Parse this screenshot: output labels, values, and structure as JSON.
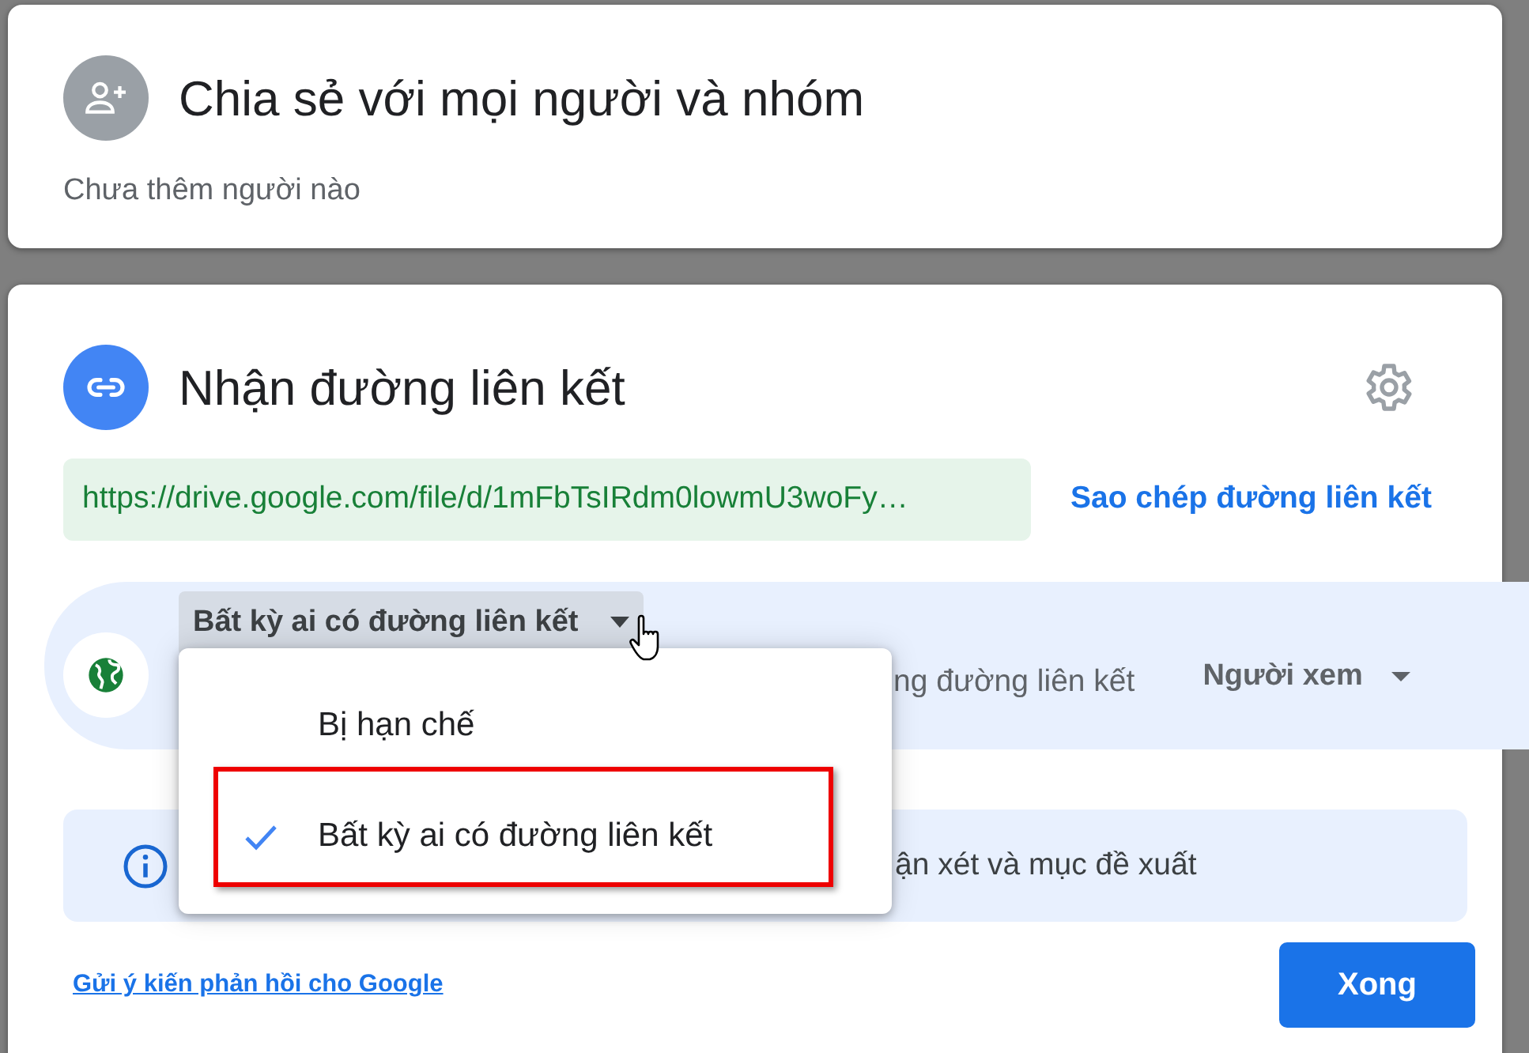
{
  "share_card": {
    "title": "Chia sẻ với mọi người và nhóm",
    "subtitle": "Chưa thêm người nào"
  },
  "link_card": {
    "title": "Nhận đường liên kết",
    "url": "https://drive.google.com/file/d/1mFbTsIRdm0lowmU3woFy…",
    "copy_link": "Sao chép đường liên kết",
    "access": {
      "dropdown": "Bất kỳ ai có đường liên kết",
      "description": "ng đường liên kết",
      "role": "Người xem"
    },
    "info": "ận xét và mục đề xuất",
    "feedback_link": "Gửi ý kiến phản hồi cho Google",
    "done_button": "Xong"
  },
  "access_menu": {
    "items": [
      {
        "label": "Bị hạn chế",
        "selected": false
      },
      {
        "label": "Bất kỳ ai có đường liên kết",
        "selected": true
      }
    ]
  }
}
